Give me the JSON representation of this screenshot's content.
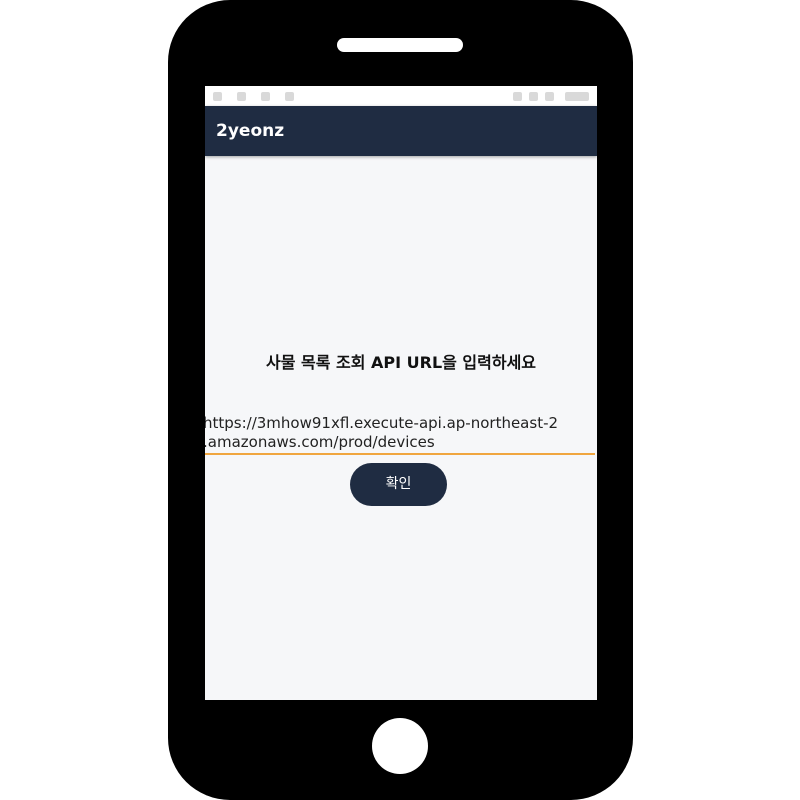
{
  "app_bar": {
    "title": "2yeonz",
    "background_color": "#1f2c42"
  },
  "main": {
    "prompt": "사물 목록 조회 API URL을 입력하세요",
    "url_input": {
      "value": "https://3mhow91xfl.execute-api.ap-northeast-2\n.amazonaws.com/prod/devices",
      "underline_color": "#f0a640"
    },
    "confirm_button": {
      "label": "확인",
      "background_color": "#1f2c42"
    }
  },
  "device": {
    "frame_color": "#000000",
    "screen_background": "#f6f7f9"
  }
}
